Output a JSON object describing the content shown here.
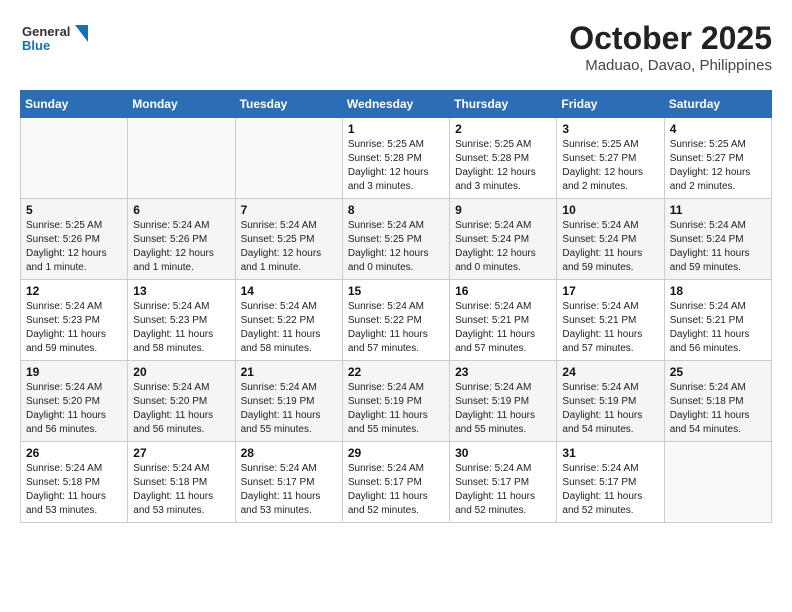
{
  "logo": {
    "line1": "General",
    "line2": "Blue"
  },
  "title": "October 2025",
  "location": "Maduao, Davao, Philippines",
  "weekdays": [
    "Sunday",
    "Monday",
    "Tuesday",
    "Wednesday",
    "Thursday",
    "Friday",
    "Saturday"
  ],
  "weeks": [
    [
      {
        "day": "",
        "sunrise": "",
        "sunset": "",
        "daylight": ""
      },
      {
        "day": "",
        "sunrise": "",
        "sunset": "",
        "daylight": ""
      },
      {
        "day": "",
        "sunrise": "",
        "sunset": "",
        "daylight": ""
      },
      {
        "day": "1",
        "sunrise": "Sunrise: 5:25 AM",
        "sunset": "Sunset: 5:28 PM",
        "daylight": "Daylight: 12 hours and 3 minutes."
      },
      {
        "day": "2",
        "sunrise": "Sunrise: 5:25 AM",
        "sunset": "Sunset: 5:28 PM",
        "daylight": "Daylight: 12 hours and 3 minutes."
      },
      {
        "day": "3",
        "sunrise": "Sunrise: 5:25 AM",
        "sunset": "Sunset: 5:27 PM",
        "daylight": "Daylight: 12 hours and 2 minutes."
      },
      {
        "day": "4",
        "sunrise": "Sunrise: 5:25 AM",
        "sunset": "Sunset: 5:27 PM",
        "daylight": "Daylight: 12 hours and 2 minutes."
      }
    ],
    [
      {
        "day": "5",
        "sunrise": "Sunrise: 5:25 AM",
        "sunset": "Sunset: 5:26 PM",
        "daylight": "Daylight: 12 hours and 1 minute."
      },
      {
        "day": "6",
        "sunrise": "Sunrise: 5:24 AM",
        "sunset": "Sunset: 5:26 PM",
        "daylight": "Daylight: 12 hours and 1 minute."
      },
      {
        "day": "7",
        "sunrise": "Sunrise: 5:24 AM",
        "sunset": "Sunset: 5:25 PM",
        "daylight": "Daylight: 12 hours and 1 minute."
      },
      {
        "day": "8",
        "sunrise": "Sunrise: 5:24 AM",
        "sunset": "Sunset: 5:25 PM",
        "daylight": "Daylight: 12 hours and 0 minutes."
      },
      {
        "day": "9",
        "sunrise": "Sunrise: 5:24 AM",
        "sunset": "Sunset: 5:24 PM",
        "daylight": "Daylight: 12 hours and 0 minutes."
      },
      {
        "day": "10",
        "sunrise": "Sunrise: 5:24 AM",
        "sunset": "Sunset: 5:24 PM",
        "daylight": "Daylight: 11 hours and 59 minutes."
      },
      {
        "day": "11",
        "sunrise": "Sunrise: 5:24 AM",
        "sunset": "Sunset: 5:24 PM",
        "daylight": "Daylight: 11 hours and 59 minutes."
      }
    ],
    [
      {
        "day": "12",
        "sunrise": "Sunrise: 5:24 AM",
        "sunset": "Sunset: 5:23 PM",
        "daylight": "Daylight: 11 hours and 59 minutes."
      },
      {
        "day": "13",
        "sunrise": "Sunrise: 5:24 AM",
        "sunset": "Sunset: 5:23 PM",
        "daylight": "Daylight: 11 hours and 58 minutes."
      },
      {
        "day": "14",
        "sunrise": "Sunrise: 5:24 AM",
        "sunset": "Sunset: 5:22 PM",
        "daylight": "Daylight: 11 hours and 58 minutes."
      },
      {
        "day": "15",
        "sunrise": "Sunrise: 5:24 AM",
        "sunset": "Sunset: 5:22 PM",
        "daylight": "Daylight: 11 hours and 57 minutes."
      },
      {
        "day": "16",
        "sunrise": "Sunrise: 5:24 AM",
        "sunset": "Sunset: 5:21 PM",
        "daylight": "Daylight: 11 hours and 57 minutes."
      },
      {
        "day": "17",
        "sunrise": "Sunrise: 5:24 AM",
        "sunset": "Sunset: 5:21 PM",
        "daylight": "Daylight: 11 hours and 57 minutes."
      },
      {
        "day": "18",
        "sunrise": "Sunrise: 5:24 AM",
        "sunset": "Sunset: 5:21 PM",
        "daylight": "Daylight: 11 hours and 56 minutes."
      }
    ],
    [
      {
        "day": "19",
        "sunrise": "Sunrise: 5:24 AM",
        "sunset": "Sunset: 5:20 PM",
        "daylight": "Daylight: 11 hours and 56 minutes."
      },
      {
        "day": "20",
        "sunrise": "Sunrise: 5:24 AM",
        "sunset": "Sunset: 5:20 PM",
        "daylight": "Daylight: 11 hours and 56 minutes."
      },
      {
        "day": "21",
        "sunrise": "Sunrise: 5:24 AM",
        "sunset": "Sunset: 5:19 PM",
        "daylight": "Daylight: 11 hours and 55 minutes."
      },
      {
        "day": "22",
        "sunrise": "Sunrise: 5:24 AM",
        "sunset": "Sunset: 5:19 PM",
        "daylight": "Daylight: 11 hours and 55 minutes."
      },
      {
        "day": "23",
        "sunrise": "Sunrise: 5:24 AM",
        "sunset": "Sunset: 5:19 PM",
        "daylight": "Daylight: 11 hours and 55 minutes."
      },
      {
        "day": "24",
        "sunrise": "Sunrise: 5:24 AM",
        "sunset": "Sunset: 5:19 PM",
        "daylight": "Daylight: 11 hours and 54 minutes."
      },
      {
        "day": "25",
        "sunrise": "Sunrise: 5:24 AM",
        "sunset": "Sunset: 5:18 PM",
        "daylight": "Daylight: 11 hours and 54 minutes."
      }
    ],
    [
      {
        "day": "26",
        "sunrise": "Sunrise: 5:24 AM",
        "sunset": "Sunset: 5:18 PM",
        "daylight": "Daylight: 11 hours and 53 minutes."
      },
      {
        "day": "27",
        "sunrise": "Sunrise: 5:24 AM",
        "sunset": "Sunset: 5:18 PM",
        "daylight": "Daylight: 11 hours and 53 minutes."
      },
      {
        "day": "28",
        "sunrise": "Sunrise: 5:24 AM",
        "sunset": "Sunset: 5:17 PM",
        "daylight": "Daylight: 11 hours and 53 minutes."
      },
      {
        "day": "29",
        "sunrise": "Sunrise: 5:24 AM",
        "sunset": "Sunset: 5:17 PM",
        "daylight": "Daylight: 11 hours and 52 minutes."
      },
      {
        "day": "30",
        "sunrise": "Sunrise: 5:24 AM",
        "sunset": "Sunset: 5:17 PM",
        "daylight": "Daylight: 11 hours and 52 minutes."
      },
      {
        "day": "31",
        "sunrise": "Sunrise: 5:24 AM",
        "sunset": "Sunset: 5:17 PM",
        "daylight": "Daylight: 11 hours and 52 minutes."
      },
      {
        "day": "",
        "sunrise": "",
        "sunset": "",
        "daylight": ""
      }
    ]
  ]
}
